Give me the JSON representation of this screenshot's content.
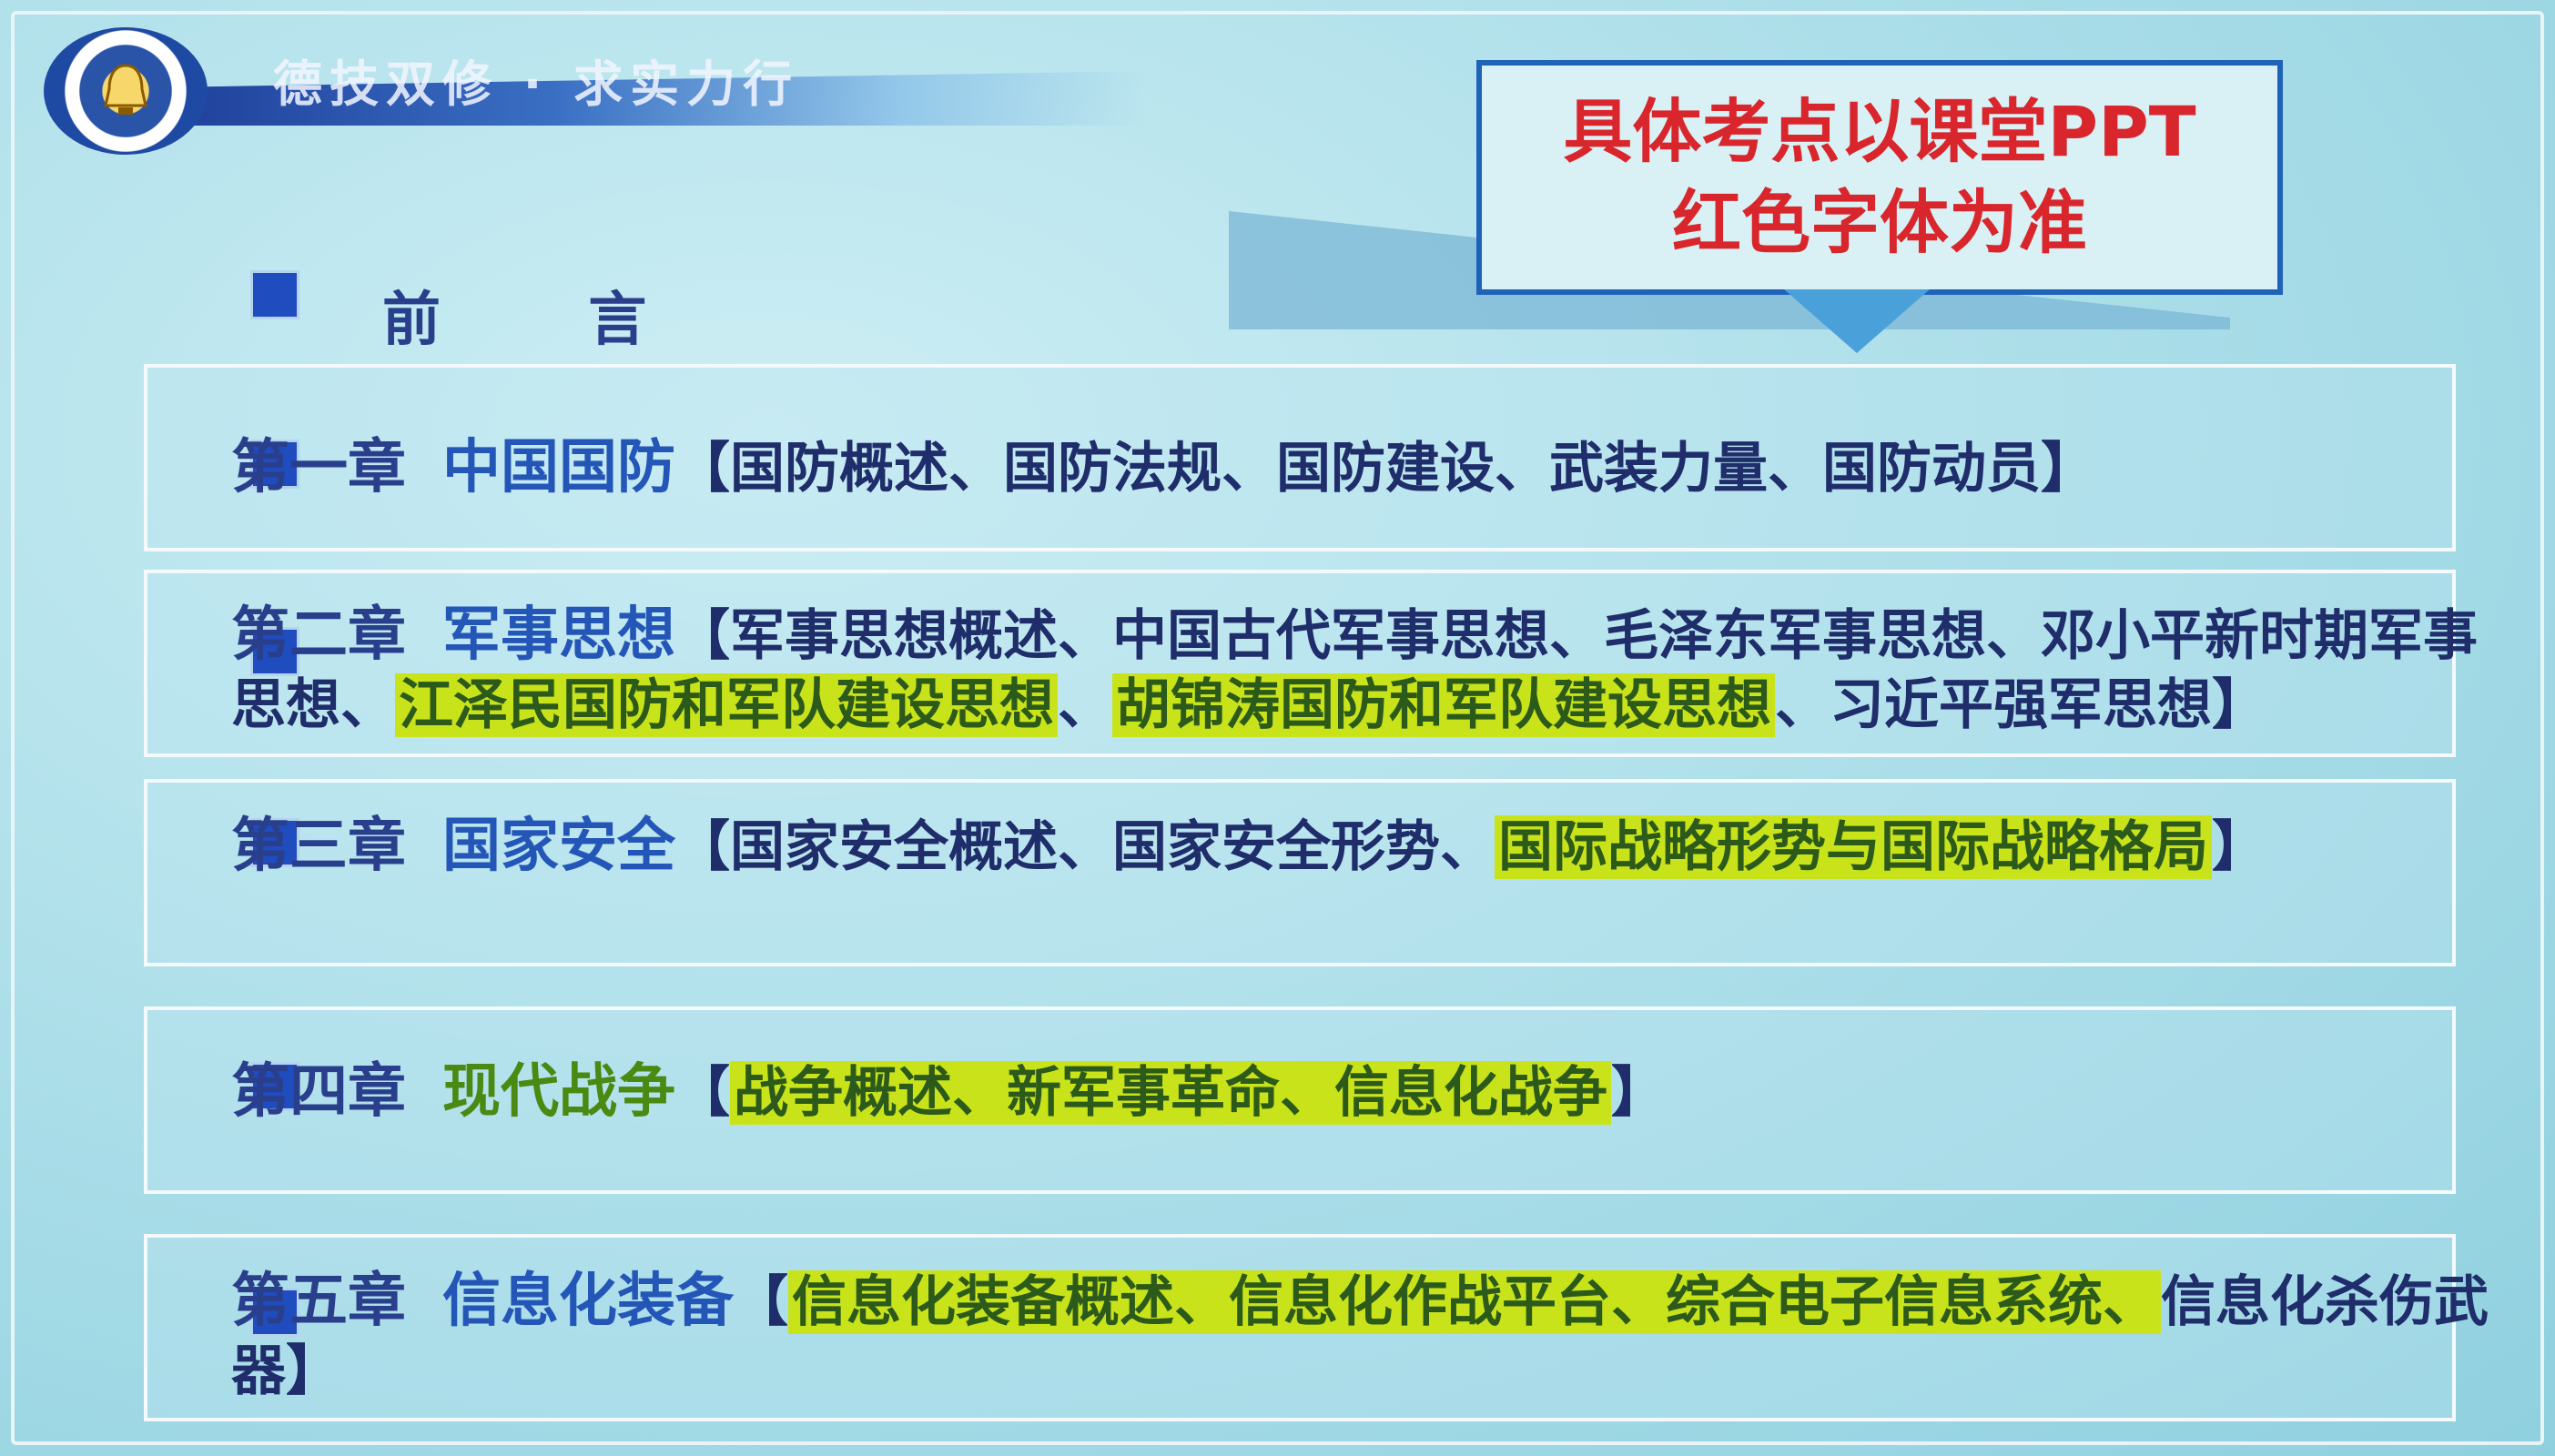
{
  "header": {
    "slogan": "德技双修 · 求实力行",
    "emblem_icon": "bell-emblem-icon",
    "accent": "#1f4aa3"
  },
  "callout": {
    "line1": "具体考点以课堂PPT",
    "line2": "红色字体为准",
    "color": "#d8262c"
  },
  "preface": {
    "label": "前 言"
  },
  "chapters": [
    {
      "title": "第一章",
      "name": "中国国防",
      "open": "【",
      "topics": [
        "国防概述、国防法规、国防建设、武装力量、国防动员"
      ],
      "close": "】"
    },
    {
      "title": "第二章",
      "name": "军事思想",
      "open": "【",
      "topic_a": "军事思想概述、中国古代军事思想、毛泽东军事思想、邓小平新时期军事思想、",
      "topic_hl1": "江泽民国防和军队建设思想",
      "sep": "、",
      "topic_hl2": "胡锦涛国防和军队建设思想",
      "topic_b": "、习近平强军思想",
      "close": "】"
    },
    {
      "title": "第三章",
      "name": "国家安全",
      "open": "【",
      "topic_a": "国家安全概述、国家安全形势、",
      "topic_hl": "国际战略形势与国际战略格局",
      "close": "】"
    },
    {
      "title": "第四章",
      "name": "现代战争",
      "open": "【",
      "topic_hl": "战争概述、新军事革命、信息化战争",
      "close": "】"
    },
    {
      "title": "第五章",
      "name": "信息化装备",
      "open": "【",
      "topic_hl": "信息化装备概述、信息化作战平台、综合电子信息系统、",
      "topic_b": "信息化杀伤武器",
      "close": "】"
    }
  ],
  "colors": {
    "highlight": "#c9e31a",
    "bullet": "#1f4cbf",
    "text": "#2b3d7e"
  }
}
